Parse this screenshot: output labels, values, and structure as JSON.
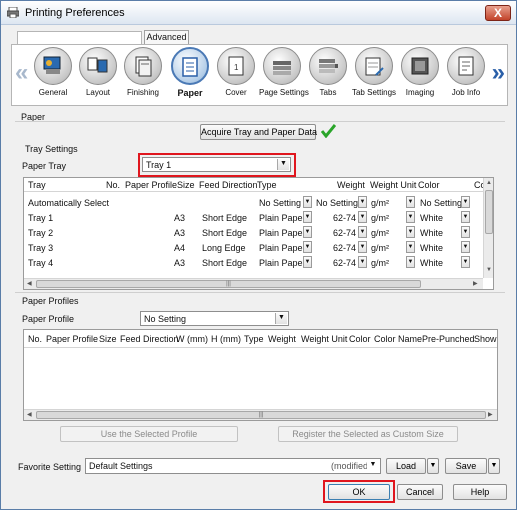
{
  "window": {
    "title": "Printing Preferences",
    "close_label": "X"
  },
  "tabs": {
    "advanced": "Advanced"
  },
  "nav": {
    "items": [
      {
        "label": "General",
        "icon": "general-icon"
      },
      {
        "label": "Layout",
        "icon": "layout-icon"
      },
      {
        "label": "Finishing",
        "icon": "finishing-icon"
      },
      {
        "label": "Paper",
        "icon": "paper-icon",
        "active": true
      },
      {
        "label": "Cover",
        "icon": "cover-icon"
      },
      {
        "label": "Page Settings",
        "icon": "page-settings-icon"
      },
      {
        "label": "Tabs",
        "icon": "tabs-icon"
      },
      {
        "label": "Tab Settings",
        "icon": "tab-settings-icon"
      },
      {
        "label": "Imaging",
        "icon": "imaging-icon"
      },
      {
        "label": "Job Info",
        "icon": "job-info-icon"
      }
    ],
    "prev_arrow": "«",
    "next_arrow": "»"
  },
  "paper": {
    "section_label": "Paper",
    "acquire_button": "Acquire Tray and Paper Data",
    "tray_settings_label": "Tray Settings",
    "paper_tray_label": "Paper Tray",
    "paper_tray_value": "Tray 1",
    "tray_table": {
      "columns": [
        "Tray",
        "No.",
        "Paper Profile",
        "Size",
        "Feed Direction",
        "Type",
        "Weight",
        "Weight Unit",
        "Color",
        "Co"
      ],
      "rows": [
        {
          "tray": "Automatically Select",
          "no": "",
          "profile": "",
          "size": "",
          "feed": "",
          "type": "No Setting",
          "weight": "No Setting",
          "unit": "g/m²",
          "color": "No Setting"
        },
        {
          "tray": "Tray 1",
          "no": "",
          "profile": "",
          "size": "A3",
          "feed": "Short Edge",
          "type": "Plain Paper",
          "weight": "62-74",
          "unit": "g/m²",
          "color": "White"
        },
        {
          "tray": "Tray 2",
          "no": "",
          "profile": "",
          "size": "A3",
          "feed": "Short Edge",
          "type": "Plain Paper",
          "weight": "62-74",
          "unit": "g/m²",
          "color": "White"
        },
        {
          "tray": "Tray 3",
          "no": "",
          "profile": "",
          "size": "A4",
          "feed": "Long Edge",
          "type": "Plain Paper",
          "weight": "62-74",
          "unit": "g/m²",
          "color": "White"
        },
        {
          "tray": "Tray 4",
          "no": "",
          "profile": "",
          "size": "A3",
          "feed": "Short Edge",
          "type": "Plain Paper",
          "weight": "62-74",
          "unit": "g/m²",
          "color": "White"
        }
      ]
    },
    "paper_profiles_label": "Paper Profiles",
    "paper_profile_label": "Paper Profile",
    "paper_profile_value": "No Setting",
    "profile_table": {
      "columns": [
        "No.",
        "Paper Profile",
        "Size",
        "Feed Direction",
        "W (mm)",
        "H (mm)",
        "Type",
        "Weight",
        "Weight Unit",
        "Color",
        "Color Name",
        "Pre-Punched",
        "Show"
      ]
    },
    "use_selected_button": "Use the Selected Profile",
    "register_button": "Register the Selected as Custom Size"
  },
  "favorite": {
    "label": "Favorite Setting",
    "value": "Default Settings",
    "modified": "(modified)",
    "load_button": "Load",
    "save_button": "Save"
  },
  "footer": {
    "ok_button": "OK",
    "cancel_button": "Cancel",
    "help_button": "Help"
  },
  "colors": {
    "highlight": "#e0161e",
    "check": "#2aa52a",
    "accent": "#4a79b5"
  }
}
